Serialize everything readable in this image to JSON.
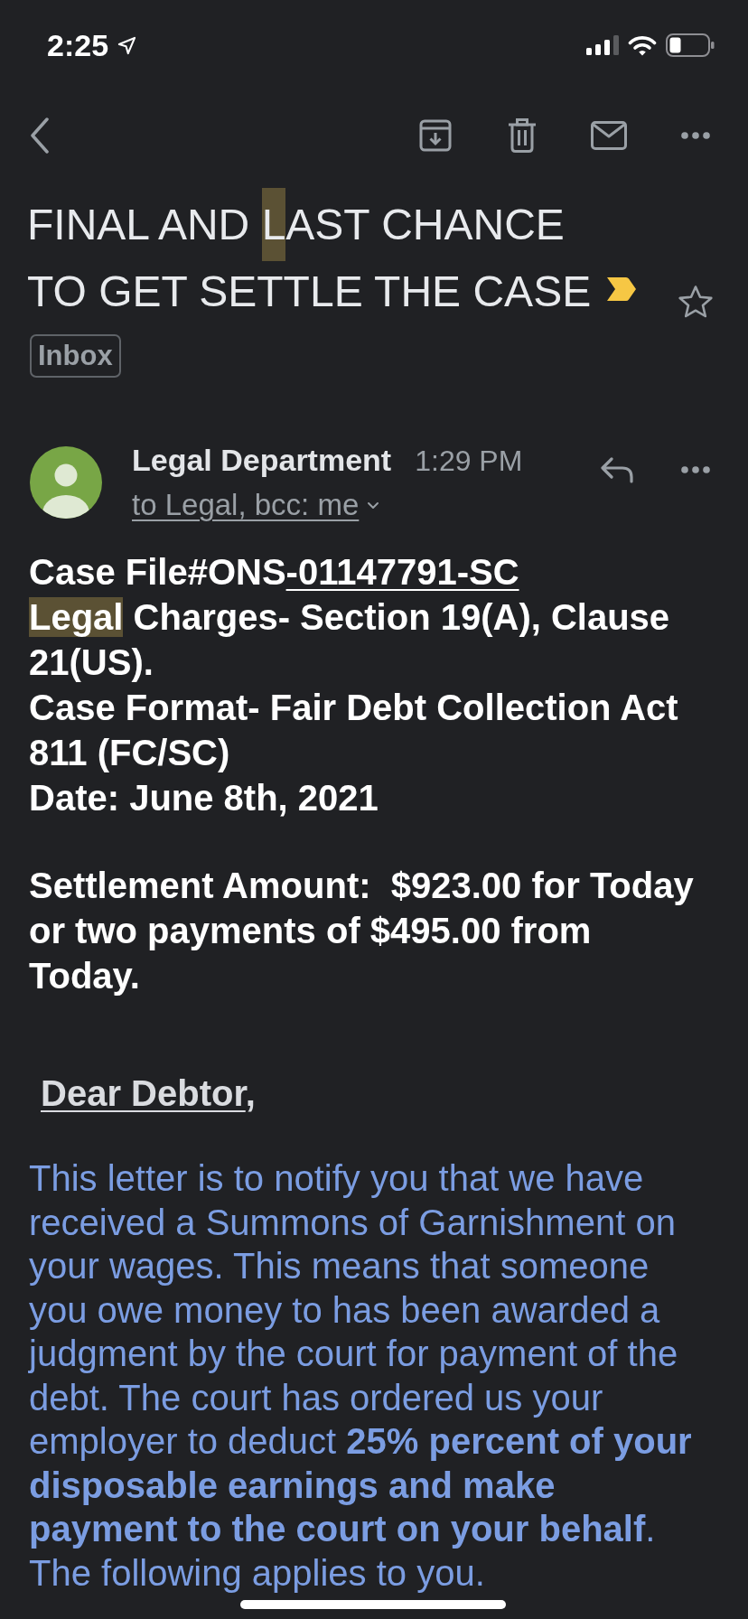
{
  "status_bar": {
    "time": "2:25"
  },
  "subject": {
    "segments": [
      {
        "text": "FINAL AND ",
        "highlighted": false
      },
      {
        "text": "L",
        "highlighted": true
      },
      {
        "text": "AST CHANCE TO GET SETTLE THE CASE",
        "highlighted": false
      }
    ],
    "important": true,
    "starred": false
  },
  "labels": [
    "Inbox"
  ],
  "message": {
    "sender": "Legal Department",
    "time": "1:29 PM",
    "recipients": "to Legal, bcc: me",
    "body": [
      {
        "kind": "detail",
        "segments": [
          {
            "text": "Case File#ONS",
            "underlined": false,
            "highlighted": false
          },
          {
            "text": "-01147791-SC",
            "underlined": true,
            "highlighted": false
          }
        ]
      },
      {
        "kind": "detail",
        "segments": [
          {
            "text": "Legal",
            "underlined": false,
            "highlighted": true
          },
          {
            "text": " Charges- Section 19(A), Clause 21(US).",
            "underlined": false,
            "highlighted": false
          }
        ]
      },
      {
        "kind": "detail",
        "segments": [
          {
            "text": "Case Format- Fair Debt Collection Act 811 (FC/SC)",
            "underlined": false,
            "highlighted": false
          }
        ]
      },
      {
        "kind": "detail",
        "segments": [
          {
            "text": "Date: June 8th, 2021",
            "underlined": false,
            "highlighted": false
          }
        ]
      },
      {
        "kind": "settlement",
        "segments": [
          {
            "text": "Settlement Amount:  $923.00 for Today or two payments of $495.00 from Today.",
            "underlined": false,
            "highlighted": false
          }
        ]
      },
      {
        "kind": "salutation",
        "segments": [
          {
            "text": "Dear Debtor",
            "underlined": true,
            "highlighted": false
          },
          {
            "text": ",",
            "underlined": false,
            "highlighted": false
          }
        ]
      },
      {
        "kind": "letter",
        "text": "This letter is to notify you that we have received a Summons of Garnishment on your wages. This means that someone you owe money to has been awarded a judgment by the court for payment of the debt. The court has ordered us your employer to deduct **25% percent of your disposable earnings and make payment to the court on your behalf**. The following applies to you."
      }
    ]
  }
}
